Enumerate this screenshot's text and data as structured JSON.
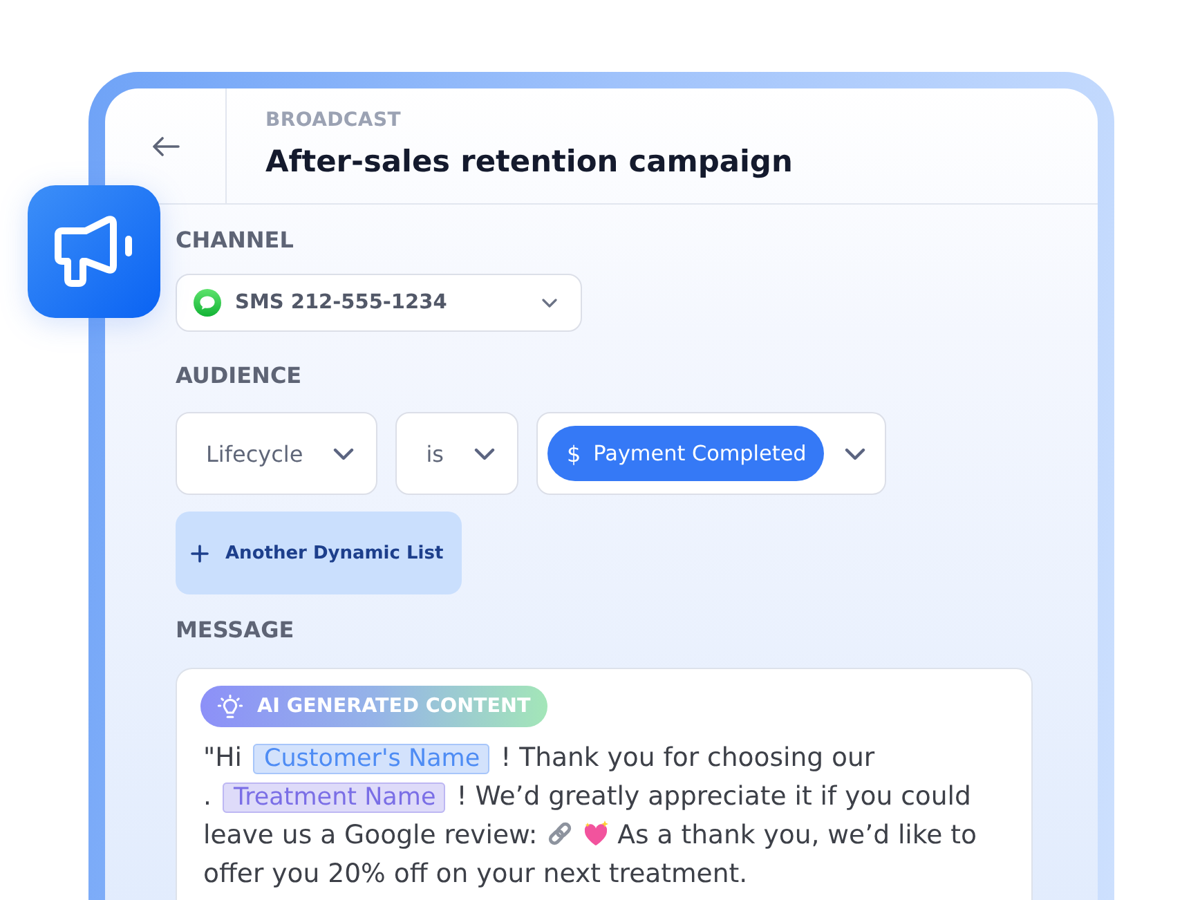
{
  "header": {
    "eyebrow": "BROADCAST",
    "title": "After-sales retention campaign"
  },
  "channel": {
    "label": "CHANNEL",
    "value": "SMS 212-555-1234"
  },
  "audience": {
    "label": "AUDIENCE",
    "filters": [
      {
        "kind": "select",
        "value": "Lifecycle"
      },
      {
        "kind": "select",
        "value": "is"
      },
      {
        "kind": "chip",
        "symbol": "$",
        "value": "Payment Completed"
      }
    ],
    "add_button": "Another Dynamic List"
  },
  "message": {
    "label": "MESSAGE",
    "badge": "AI GENERATED CONTENT",
    "lines": [
      {
        "segments": [
          {
            "kind": "text",
            "text": "\"Hi"
          },
          {
            "kind": "variable",
            "text": "Customer's Name",
            "color": "#4e8cf4"
          },
          {
            "kind": "text",
            "text": "! Thank you for choosing our"
          }
        ]
      },
      {
        "segments": [
          {
            "kind": "text",
            "text": "."
          },
          {
            "kind": "variable",
            "text": "Treatment Name",
            "color": "#7a6ee6"
          },
          {
            "kind": "text",
            "text": "! We’d greatly appreciate it if you could"
          }
        ]
      },
      {
        "segments": [
          {
            "kind": "text",
            "text": "leave us a Google review:"
          },
          {
            "kind": "link"
          },
          {
            "kind": "heart"
          },
          {
            "kind": "text",
            "text": "As a thank you, we’d like to"
          }
        ]
      },
      {
        "segments": [
          {
            "kind": "text",
            "text": "offer you 20% off on your next treatment."
          }
        ]
      }
    ]
  }
}
